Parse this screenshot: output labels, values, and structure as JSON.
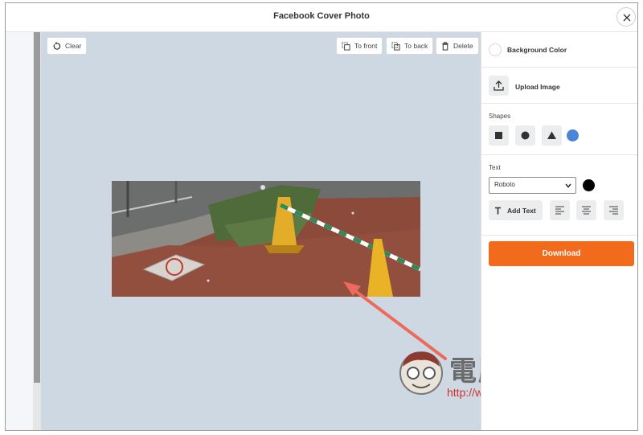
{
  "window": {
    "title": "Facebook Cover Photo",
    "close_icon": "close-icon"
  },
  "toolbar": {
    "clear_label": "Clear",
    "to_front_label": "To front",
    "to_back_label": "To back",
    "delete_label": "Delete"
  },
  "watermark": {
    "chinese": "電腦王阿達",
    "url": "http://www.kocpc.com.tw"
  },
  "panel": {
    "background_color_label": "Background Color",
    "upload_image_label": "Upload Image",
    "shapes_heading": "Shapes",
    "shapes": [
      "square",
      "circle",
      "triangle"
    ],
    "shape_color": "#4a86d8",
    "text_heading": "Text",
    "font_value": "Roboto",
    "text_color": "#000000",
    "add_text_label": "Add Text",
    "align_options": [
      "left",
      "center",
      "right"
    ],
    "download_label": "Download"
  },
  "colors": {
    "accent": "#f26a1b",
    "canvas_bg": "#cdd8e3",
    "arrow": "#ec6b5f"
  }
}
